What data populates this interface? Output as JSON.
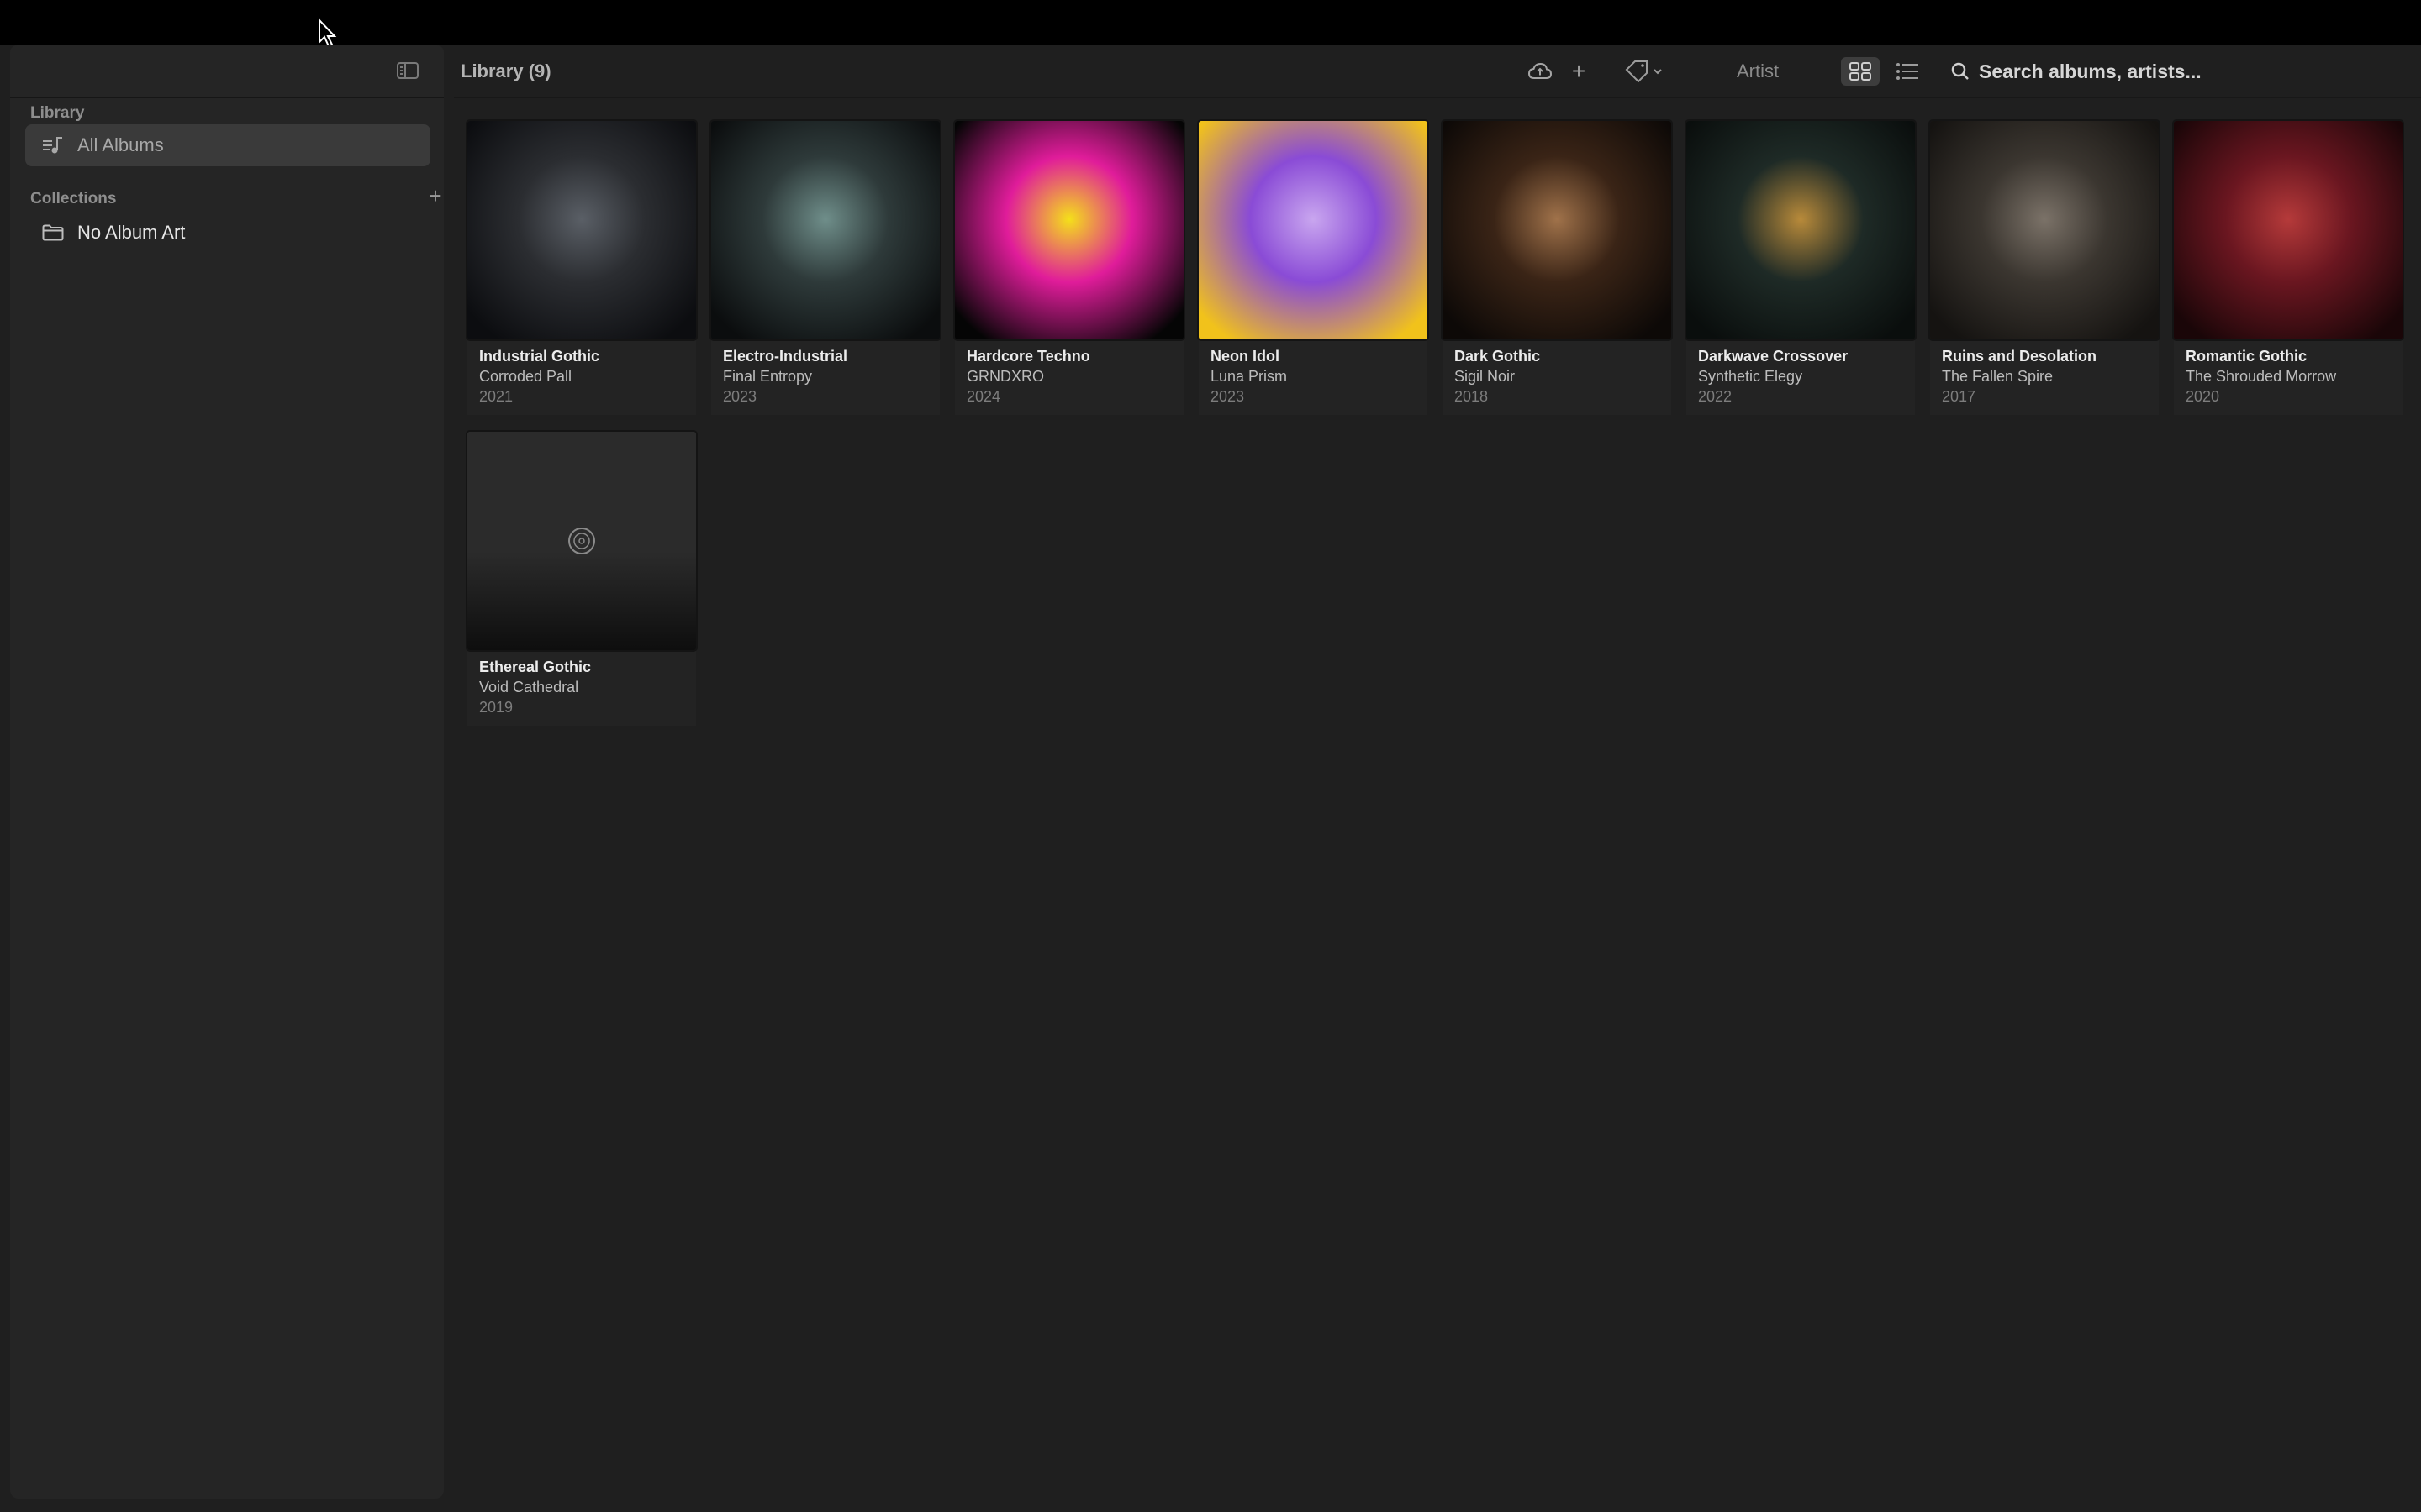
{
  "window": {
    "title": "Library (9)"
  },
  "sidebar": {
    "library_label": "Library",
    "library_items": [
      {
        "label": "All Albums",
        "icon": "music-note-list-icon",
        "selected": true
      }
    ],
    "collections_label": "Collections",
    "collection_items": [
      {
        "label": "No Album Art",
        "icon": "folder-icon"
      }
    ]
  },
  "toolbar": {
    "sort_value": "Artist",
    "view_mode": "grid",
    "search_placeholder": "Search albums, artists..."
  },
  "albums": [
    {
      "title": "Industrial Gothic",
      "artist": "Corroded Pall",
      "year": "2021",
      "palette": [
        "#2b2d31",
        "#0c0d10",
        "#5a5f66"
      ]
    },
    {
      "title": "Electro-Industrial",
      "artist": "Final Entropy",
      "year": "2023",
      "palette": [
        "#2e3a3a",
        "#0b0d0e",
        "#6f8e8a"
      ]
    },
    {
      "title": "Hardcore Techno",
      "artist": "GRNDXRO",
      "year": "2024",
      "palette": [
        "#e01c9a",
        "#050505",
        "#f4e01a"
      ]
    },
    {
      "title": "Neon Idol",
      "artist": "Luna Prism",
      "year": "2023",
      "palette": [
        "#8a4bd6",
        "#f1c21b",
        "#c9a6ef"
      ]
    },
    {
      "title": "Dark Gothic",
      "artist": "Sigil Noir",
      "year": "2018",
      "palette": [
        "#3a2416",
        "#0d0907",
        "#a0724a"
      ]
    },
    {
      "title": "Darkwave Crossover",
      "artist": "Synthetic Elegy",
      "year": "2022",
      "palette": [
        "#1e2a26",
        "#0a0e0d",
        "#b88a3a"
      ]
    },
    {
      "title": "Ruins and Desolation",
      "artist": "The Fallen Spire",
      "year": "2017",
      "palette": [
        "#3b3630",
        "#151311",
        "#7b7268"
      ]
    },
    {
      "title": "Romantic Gothic",
      "artist": "The Shrouded Morrow",
      "year": "2020",
      "palette": [
        "#6a1620",
        "#1a0608",
        "#b53a3a"
      ]
    },
    {
      "title": "Ethereal Gothic",
      "artist": "Void Cathedral",
      "year": "2019",
      "palette": [
        "#2a2a2a",
        "#0d0d0d",
        "#9a9a9a"
      ],
      "placeholder_art": true
    }
  ]
}
